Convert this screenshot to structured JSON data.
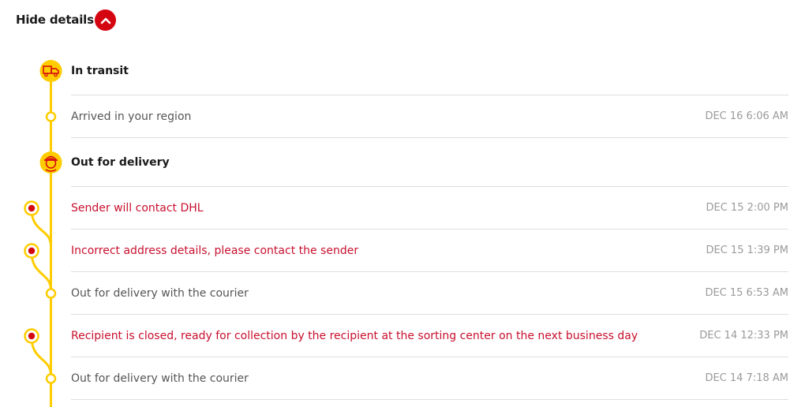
{
  "header": {
    "toggle_label": "Hide details"
  },
  "colors": {
    "accent_red": "#d40511",
    "timeline_yellow": "#ffcc00",
    "alert_text": "#c8102e"
  },
  "events": [
    {
      "type": "heading",
      "icon": "truck-icon",
      "text": "In transit",
      "time": ""
    },
    {
      "type": "normal",
      "text": "Arrived in your region",
      "time": "DEC 16 6:06 AM"
    },
    {
      "type": "heading",
      "icon": "courier-icon",
      "text": "Out for delivery",
      "time": ""
    },
    {
      "type": "alert",
      "text": "Sender will contact DHL",
      "time": "DEC 15 2:00 PM"
    },
    {
      "type": "alert",
      "text": "Incorrect address details, please contact the sender",
      "time": "DEC 15 1:39 PM"
    },
    {
      "type": "normal",
      "text": "Out for delivery with the courier",
      "time": "DEC 15 6:53 AM"
    },
    {
      "type": "alert",
      "text": "Recipient is closed, ready for collection by the recipient at the sorting center on the next business day",
      "time": "DEC 14 12:33 PM"
    },
    {
      "type": "normal",
      "text": "Out for delivery with the courier",
      "time": "DEC 14 7:18 AM"
    }
  ]
}
